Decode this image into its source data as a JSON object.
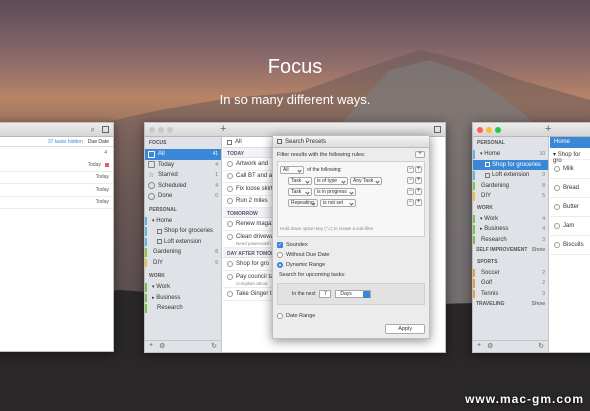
{
  "hero": {
    "title": "Focus",
    "subtitle": "In so many different ways."
  },
  "left": {
    "hidden": "37 tasks hidden",
    "sort": "Due Date",
    "count": "4",
    "rows": [
      "Today",
      "Today",
      "Today",
      "Today"
    ]
  },
  "center": {
    "sidebar_header": "FOCUS",
    "filter": "All",
    "focus": [
      {
        "label": "All",
        "count": "41"
      },
      {
        "label": "Today",
        "count": "4"
      },
      {
        "label": "Starred",
        "count": "1"
      },
      {
        "label": "Scheduled",
        "count": "4"
      },
      {
        "label": "Done",
        "count": "0"
      }
    ],
    "personal_header": "PERSONAL",
    "personal": [
      {
        "label": "Home",
        "count": ""
      },
      {
        "label": "Shop for groceries",
        "count": ""
      },
      {
        "label": "Loft extension",
        "count": ""
      },
      {
        "label": "Gardening",
        "count": "8"
      },
      {
        "label": "DIY",
        "count": "5"
      }
    ],
    "work_header": "WORK",
    "work": [
      {
        "label": "Work",
        "count": ""
      },
      {
        "label": "Business",
        "count": ""
      },
      {
        "label": "Research",
        "count": ""
      }
    ],
    "today_hdr": "TODAY",
    "today": [
      "Artwork and",
      "Call BT and ask",
      "Fix loose skirting",
      "Run 2 miles"
    ],
    "tomorrow_hdr": "TOMORROW",
    "tomorrow": [
      "Renew magazin",
      "Clean driveway"
    ],
    "tomorrow_note": "Need powerwash",
    "dat_hdr": "DAY AFTER TOMORR",
    "dat": [
      "Shop for gro",
      "Pay council ta"
    ],
    "dat_note": "Complain about",
    "dat_last": "Take Ginger to vet"
  },
  "dialog": {
    "title": "Search Presets",
    "filter_label": "Filter results with the following rules:",
    "all": "All",
    "following": "of the following:",
    "rules": [
      [
        "Task",
        "is of type",
        "Any Task"
      ],
      [
        "Task",
        "is in progress",
        ""
      ],
      [
        "Repeating",
        "is not set",
        ""
      ]
    ],
    "hint": "Hold down option key (⌥) to create a sub-filter",
    "opts": [
      "Soundex",
      "Without Due Date",
      "Dynamic Range"
    ],
    "upcoming": "Search for upcoming tasks:",
    "in_next": "In the next",
    "num": "7",
    "days": "Days",
    "date_range": "Date Range",
    "apply": "Apply"
  },
  "right": {
    "tab": "Home",
    "personal_header": "PERSONAL",
    "items": [
      {
        "label": "Home",
        "count": "10"
      },
      {
        "label": "Shop for groceries",
        "count": ""
      },
      {
        "label": "Loft extension",
        "count": "0"
      },
      {
        "label": "Gardening",
        "count": "8"
      },
      {
        "label": "DIY",
        "count": "5"
      }
    ],
    "work_header": "WORK",
    "work": [
      {
        "label": "Work",
        "count": "4"
      },
      {
        "label": "Business",
        "count": "4"
      },
      {
        "label": "Research",
        "count": "3"
      }
    ],
    "self_header": "SELF IMPROVEMENT",
    "show": "Show",
    "sports_header": "SPORTS",
    "sports": [
      {
        "label": "Soccer",
        "count": "2"
      },
      {
        "label": "Golf",
        "count": "2"
      },
      {
        "label": "Tennis",
        "count": "3"
      }
    ],
    "travel_header": "TRAVELING",
    "show2": "Show",
    "tasks_head": "Shop for gro",
    "tasks": [
      "Milk",
      "Bread",
      "Butter",
      "Jam",
      "Biscuits"
    ]
  },
  "watermark": "www.mac-gm.com",
  "colors": {
    "accent": "#3a87d6",
    "sel_row": "#3a87d6"
  }
}
